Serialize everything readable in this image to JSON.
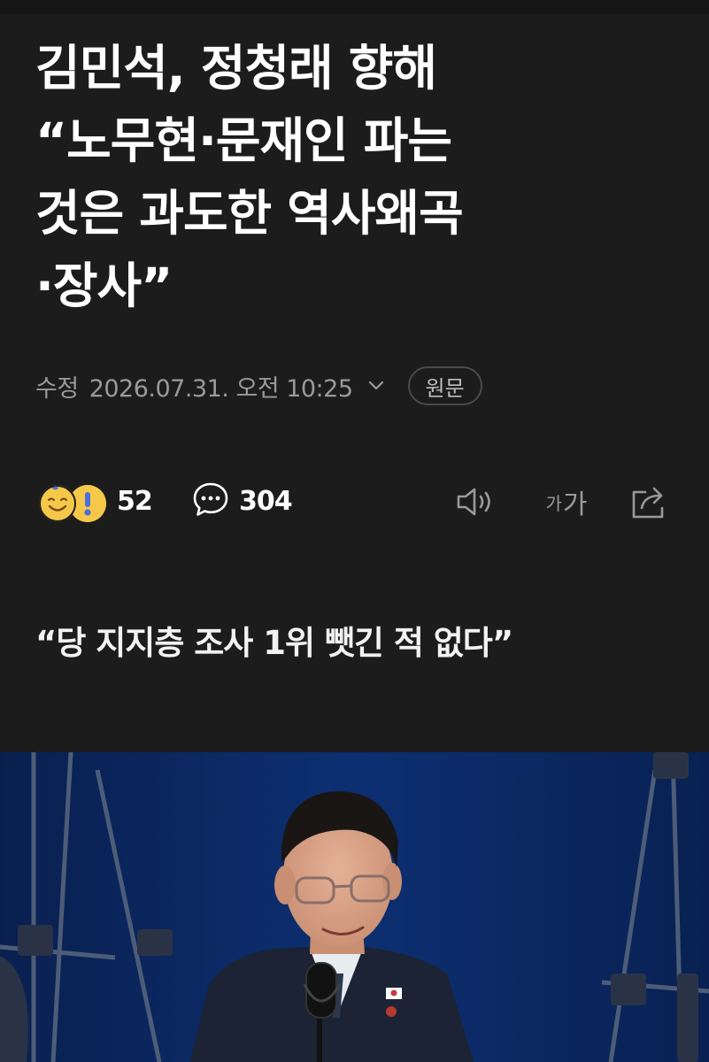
{
  "article": {
    "headline": "김민석, 정청래 향해\n“노무현·문재인 파는\n것은 과도한 역사왜곡\n·장사”",
    "meta": {
      "label": "수정",
      "datetime": "2026.07.31. 오전 10:25",
      "origin_button": "원문"
    },
    "reactions": {
      "count": "52",
      "icons": [
        "smiling-face-icon",
        "surprised-face-icon"
      ]
    },
    "comments": {
      "count": "304",
      "icon": "speech-bubble-icon"
    },
    "tools": {
      "tts_icon": "speaker-icon",
      "font_size_small": "가",
      "font_size_large": "가",
      "share_icon": "share-icon"
    },
    "subheadline": "“당 지지층 조사 1위 뺏긴 적 없다”",
    "photo": {
      "subject": "man-with-glasses-speaking-at-microphone",
      "colors": {
        "background": "#0d2f72",
        "suit": "#1b2335",
        "shirt": "#e8ecf1",
        "skin": "#d9a58a",
        "hair": "#1a1614"
      }
    }
  },
  "theme": {
    "background": "#1c1c1c",
    "text": "#ffffff",
    "muted": "#9a9a9a",
    "emoji_yellow": "#f6c84a",
    "emoji_blue": "#4a6fd8"
  }
}
